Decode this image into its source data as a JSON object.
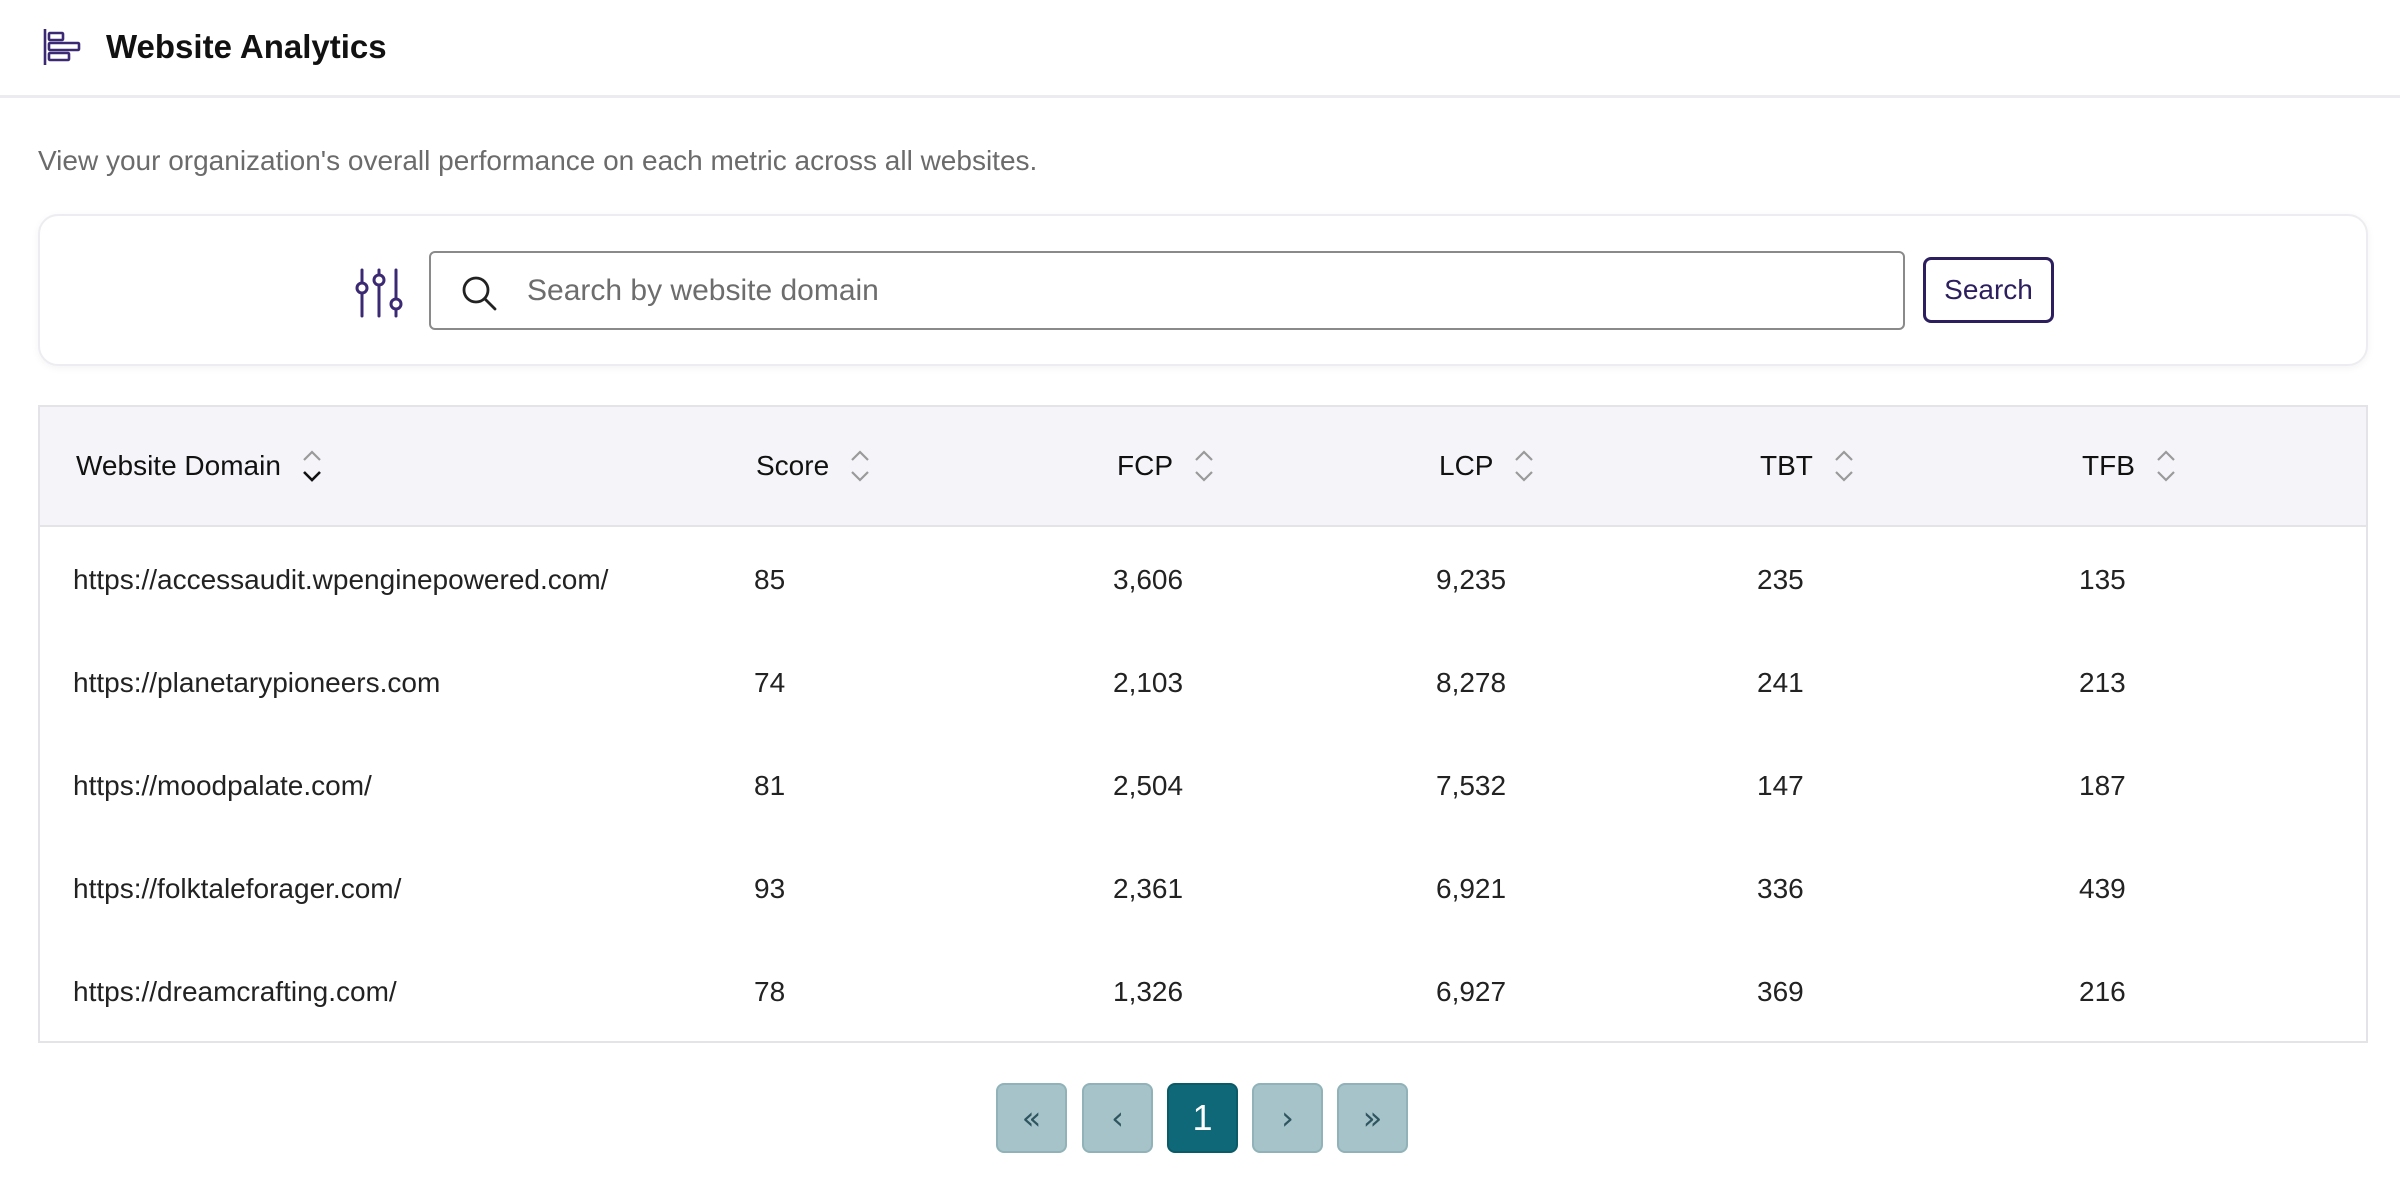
{
  "header": {
    "title": "Website Analytics",
    "logo_icon": "bar-chart-icon"
  },
  "subtitle": "View your organization's overall performance on each metric across all websites.",
  "search": {
    "placeholder": "Search by website domain",
    "value": "",
    "button_label": "Search",
    "filter_icon": "sliders-icon",
    "search_icon": "magnifier-icon"
  },
  "table": {
    "columns": [
      "Website Domain",
      "Score",
      "FCP",
      "LCP",
      "TBT",
      "TFB"
    ],
    "rows": [
      [
        "https://accessaudit.wpenginepowered.com/",
        "85",
        "3,606",
        "9,235",
        "235",
        "135"
      ],
      [
        "https://planetarypioneers.com",
        "74",
        "2,103",
        "8,278",
        "241",
        "213"
      ],
      [
        "https://moodpalate.com/",
        "81",
        "2,504",
        "7,532",
        "147",
        "187"
      ],
      [
        "https://folktaleforager.com/",
        "93",
        "2,361",
        "6,921",
        "336",
        "439"
      ],
      [
        "https://dreamcrafting.com/",
        "78",
        "1,326",
        "6,927",
        "369",
        "216"
      ]
    ]
  },
  "pagination": {
    "first": "«",
    "prev": "‹",
    "current": "1",
    "next": "›",
    "last": "»"
  },
  "colors": {
    "brand": "#2d1f5e",
    "active_page": "#0f6878",
    "inactive_page": "#a5c3c8"
  }
}
